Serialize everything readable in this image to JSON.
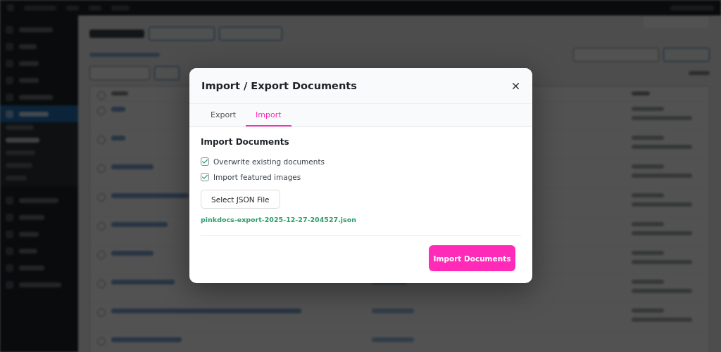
{
  "modal": {
    "title": "Import / Export Documents",
    "tabs": [
      {
        "label": "Export",
        "selected": false
      },
      {
        "label": "Import",
        "selected": true
      }
    ],
    "section_title": "Import Documents",
    "options": [
      {
        "label": "Overwrite existing documents",
        "checked": true
      },
      {
        "label": "Import featured images",
        "checked": true
      }
    ],
    "select_button": "Select JSON File",
    "file_name": "pinkdocs-export-2025-12-27-204527.json",
    "submit": "Import Documents"
  }
}
